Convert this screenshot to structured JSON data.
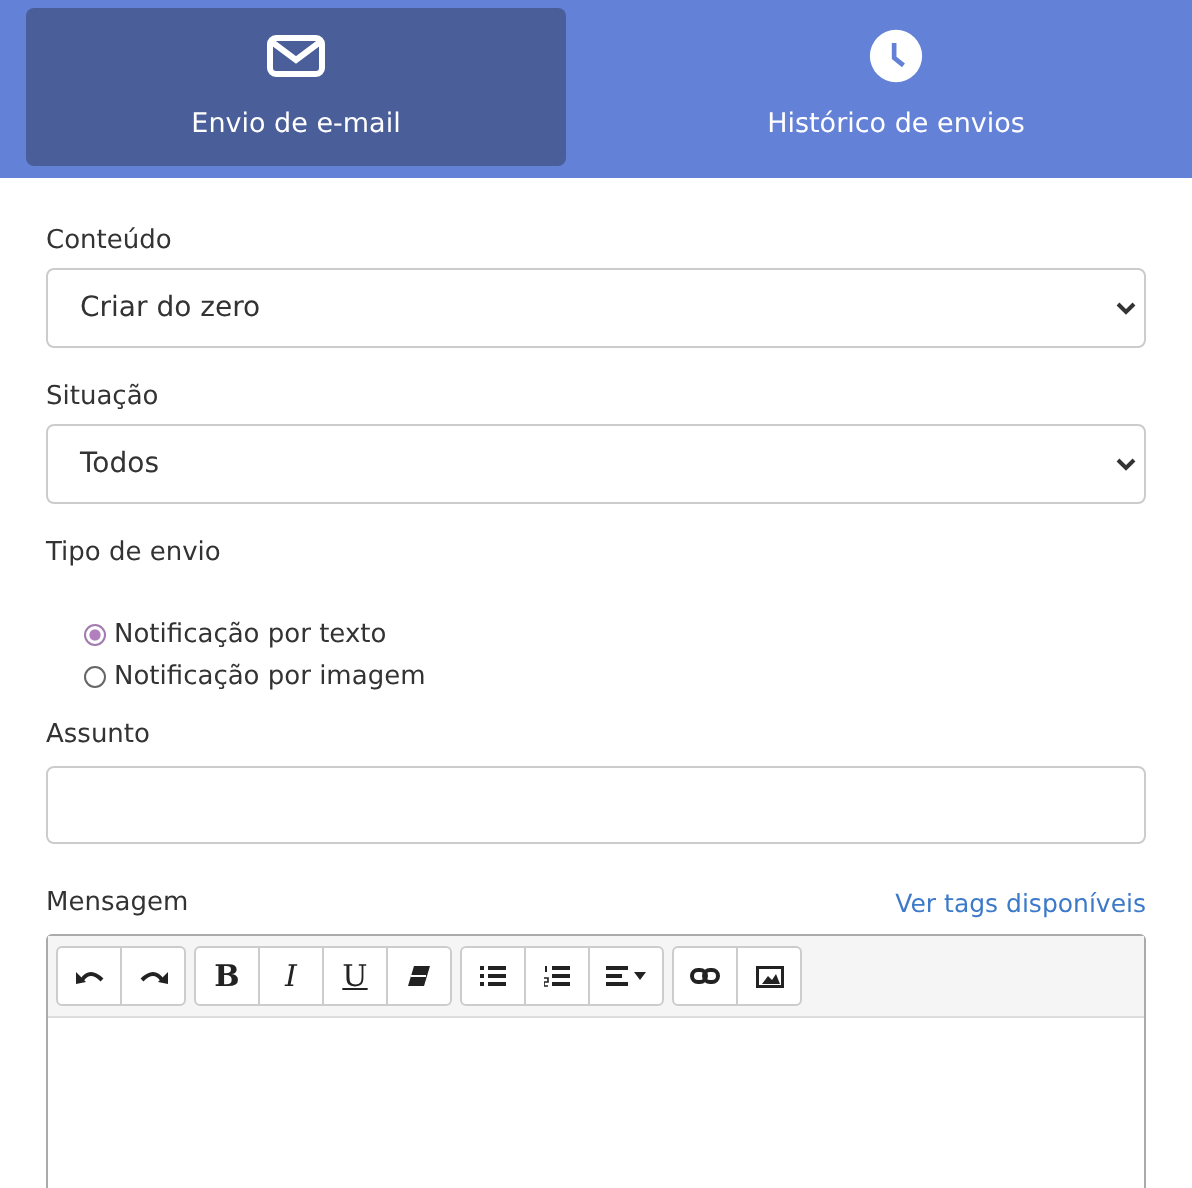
{
  "tabs": [
    {
      "label": "Envio de e-mail",
      "kind": "mail",
      "selected": true
    },
    {
      "label": "Histórico de envios",
      "kind": "clock",
      "selected": false
    }
  ],
  "content": {
    "label": "Conteúdo",
    "value": "Criar do zero"
  },
  "situation": {
    "label": "Situação",
    "value": "Todos"
  },
  "send_type": {
    "label": "Tipo de envio",
    "options": [
      {
        "label": "Notificação por texto",
        "selected": true
      },
      {
        "label": "Notificação por imagem",
        "selected": false
      }
    ]
  },
  "subject": {
    "label": "Assunto"
  },
  "message": {
    "label": "Mensagem",
    "link": "Ver tags disponíveis",
    "toolbar": [
      [
        {
          "kind": "undo"
        },
        {
          "kind": "redo"
        }
      ],
      [
        {
          "kind": "bold",
          "label": "B"
        },
        {
          "kind": "italic",
          "label": "I"
        },
        {
          "kind": "underline",
          "label": "U"
        },
        {
          "kind": "eraser"
        }
      ],
      [
        {
          "kind": "bullets"
        },
        {
          "kind": "numbers"
        },
        {
          "kind": "align"
        }
      ],
      [
        {
          "kind": "link"
        },
        {
          "kind": "image"
        }
      ]
    ]
  }
}
